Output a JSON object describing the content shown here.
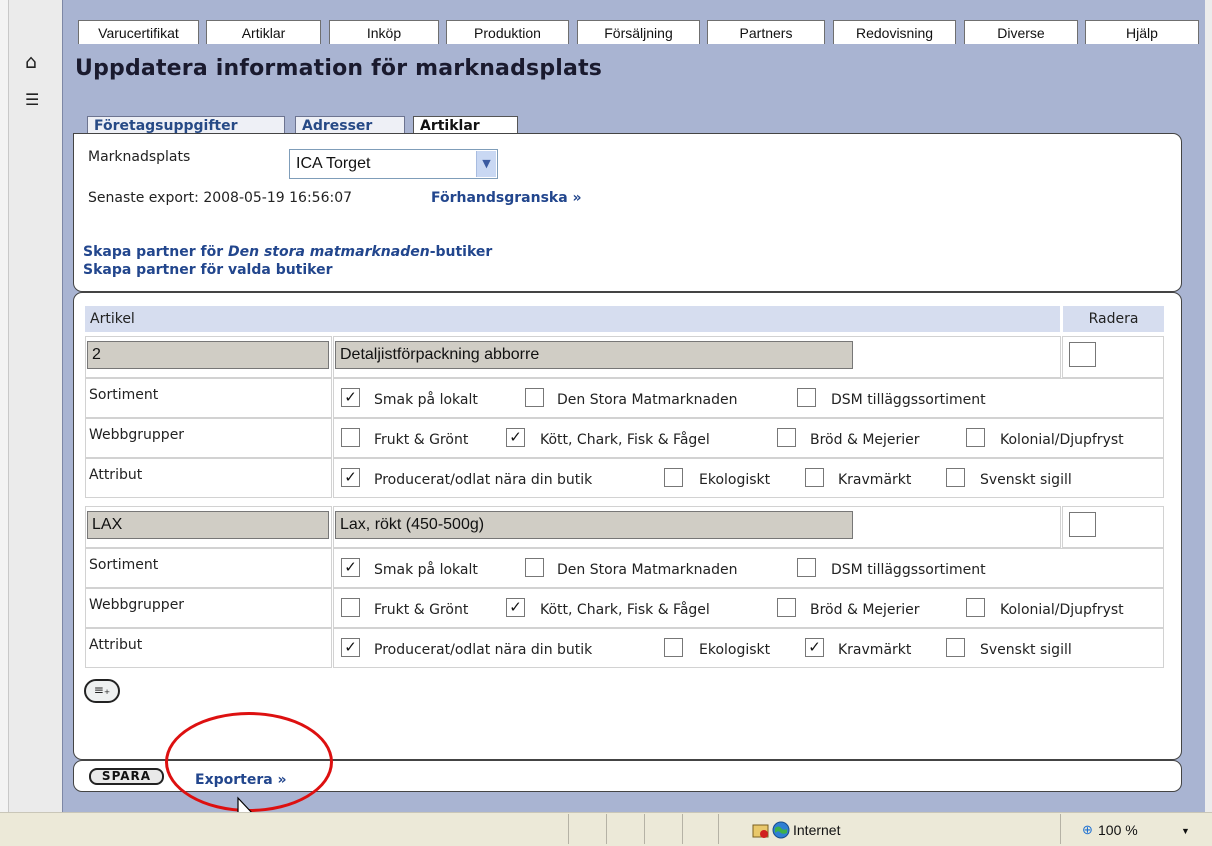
{
  "menu": [
    "Varucertifikat",
    "Artiklar",
    "Inköp",
    "Produktion",
    "Försäljning",
    "Partners",
    "Redovisning",
    "Diverse",
    "Hjälp"
  ],
  "sidebar": {
    "home_icon": "home-icon",
    "list_icon": "list-icon"
  },
  "page": {
    "title": "Uppdatera information för marknadsplats"
  },
  "tabs": [
    "Företagsuppgifter",
    "Adresser",
    "Artiklar"
  ],
  "marketplace": {
    "label": "Marknadsplats",
    "selected": "ICA Torget",
    "last_export_label": "Senaste export: 2008-05-19 16:56:07",
    "preview_link": "Förhandsgranska »",
    "create_partner_prefix": "Skapa partner för ",
    "create_partner_store": "Den stora matmarknaden",
    "create_partner_suffix": "-butiker",
    "create_partner_selected": "Skapa partner för valda butiker"
  },
  "table": {
    "col_article": "Artikel",
    "col_delete": "Radera",
    "row_labels": {
      "sortiment": "Sortiment",
      "webb": "Webbgrupper",
      "attribut": "Attribut"
    },
    "articles": [
      {
        "code": "2",
        "name": "Detaljistförpackning abborre",
        "sortiment": [
          [
            "Smak på lokalt",
            true
          ],
          [
            "Den Stora Matmarknaden",
            false
          ],
          [
            "DSM tilläggssortiment",
            false
          ]
        ],
        "webb": [
          [
            "Frukt & Grönt",
            false
          ],
          [
            "Kött, Chark, Fisk & Fågel",
            true
          ],
          [
            "Bröd & Mejerier",
            false
          ],
          [
            "Kolonial/Djupfryst",
            false
          ]
        ],
        "attribut": [
          [
            "Producerat/odlat nära din butik",
            true
          ],
          [
            "Ekologiskt",
            false
          ],
          [
            "Kravmärkt",
            false
          ],
          [
            "Svenskt sigill",
            false
          ]
        ]
      },
      {
        "code": "LAX",
        "name": "Lax, rökt (450-500g)",
        "sortiment": [
          [
            "Smak på lokalt",
            true
          ],
          [
            "Den Stora Matmarknaden",
            false
          ],
          [
            "DSM tilläggssortiment",
            false
          ]
        ],
        "webb": [
          [
            "Frukt & Grönt",
            false
          ],
          [
            "Kött, Chark, Fisk & Fågel",
            true
          ],
          [
            "Bröd & Mejerier",
            false
          ],
          [
            "Kolonial/Djupfryst",
            false
          ]
        ],
        "attribut": [
          [
            "Producerat/odlat nära din butik",
            true
          ],
          [
            "Ekologiskt",
            false
          ],
          [
            "Kravmärkt",
            true
          ],
          [
            "Svenskt sigill",
            false
          ]
        ]
      }
    ]
  },
  "actions": {
    "add_icon": "add-row-icon",
    "save": "SPARA",
    "export": "Exportera »"
  },
  "statusbar": {
    "zone": "Internet",
    "zoom": "100 %"
  },
  "colors": {
    "frame": "#a9b4d2",
    "link": "#22468d",
    "header_row": "#d6ddef",
    "annotation": "#dd1010"
  }
}
